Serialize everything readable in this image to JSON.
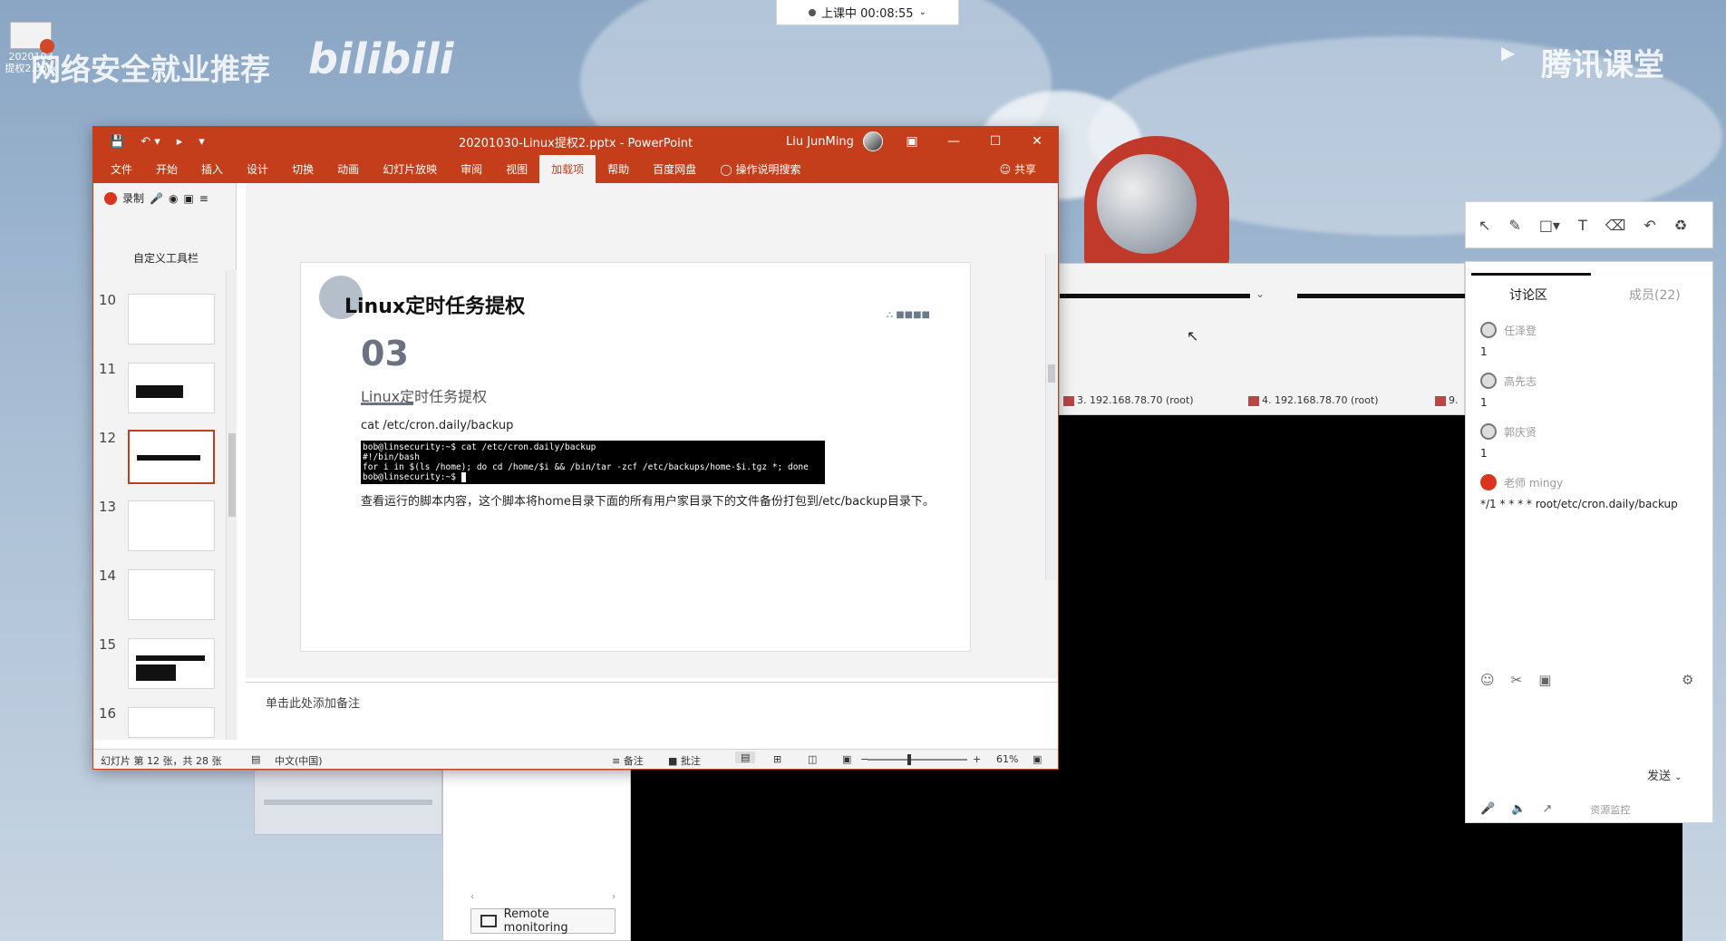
{
  "desktop": {
    "file_icon_label_1": "2020103",
    "file_icon_label_2": "提权2.pptx",
    "watermark_left": "网络安全就业推荐",
    "watermark_bili": "bilibili",
    "watermark_right": "腾讯课堂"
  },
  "live_status": {
    "label": "上课中 00:08:55"
  },
  "ppt": {
    "window_title": "20201030-Linux提权2.pptx  -  PowerPoint",
    "user": "Liu JunMing",
    "menu": [
      "文件",
      "开始",
      "插入",
      "设计",
      "切换",
      "动画",
      "幻灯片放映",
      "审阅",
      "视图",
      "加载项",
      "帮助",
      "百度网盘",
      "操作说明搜索"
    ],
    "share": "共享",
    "record": "录制",
    "custom_toolbar": "自定义工具栏",
    "thumb_numbers": [
      "10",
      "11",
      "12",
      "13",
      "14",
      "15",
      "16"
    ],
    "slide": {
      "title": "Linux定时任务提权",
      "section_number": "03",
      "section_title": "Linux定时任务提权",
      "command": "cat /etc/cron.daily/backup",
      "terminal_lines": [
        "bob@linsecurity:~$ cat /etc/cron.daily/backup",
        "#!/bin/bash",
        "for i in $(ls /home); do cd /home/$i && /bin/tar -zcf /etc/backups/home-$i.tgz *; done",
        "bob@linsecurity:~$ "
      ],
      "description": "查看运行的脚本内容，这个脚本将home目录下面的所有用户家目录下的文件备份打包到/etc/backup目录下。"
    },
    "notes_placeholder": "单击此处添加备注",
    "status": {
      "slide_info": "幻灯片 第 12 张，共 28 张",
      "language": "中文(中国)",
      "notes": "备注",
      "comments": "批注",
      "zoom": "61%"
    }
  },
  "remote": {
    "hosts": [
      "3. 192.168.78.70 (root)",
      "4. 192.168.78.70 (root)",
      "9."
    ],
    "monitor_button": "Remote monitoring"
  },
  "tencent": {
    "tab_discussion": "讨论区",
    "tab_members": "成员(22)",
    "messages": [
      {
        "name": "任泽登",
        "text": "1"
      },
      {
        "name": "高先志",
        "text": "1"
      },
      {
        "name": "郭庆贤",
        "text": "1"
      },
      {
        "name": "老师 mingy",
        "text": "*/1 * * * * root/etc/cron.daily/backup"
      }
    ],
    "send": "发送",
    "resource_monitor": "资源监控"
  },
  "colors": {
    "ppt_accent": "#c43e1c",
    "record": "#d9341d"
  }
}
